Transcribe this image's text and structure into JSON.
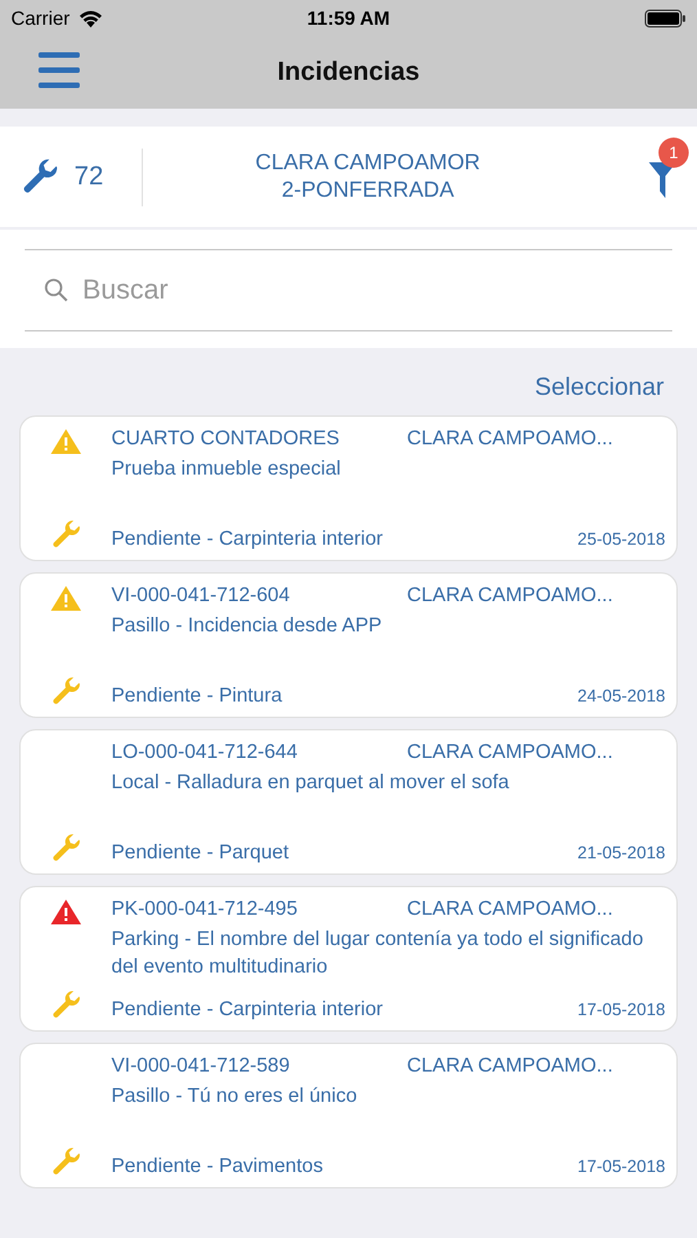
{
  "status_bar": {
    "carrier": "Carrier",
    "time": "11:59 AM"
  },
  "nav_bar": {
    "title": "Incidencias"
  },
  "header": {
    "count": "72",
    "building_line_1": "CLARA CAMPOAMOR",
    "building_line_2": "2-PONFERRADA",
    "filter_badge": "1"
  },
  "search": {
    "placeholder": "Buscar"
  },
  "select_link": "Seleccionar",
  "incidents": [
    {
      "code": "CUARTO CONTADORES",
      "location": "CLARA CAMPOAMO...",
      "description": "Prueba inmueble especial",
      "status": "Pendiente - Carpinteria interior",
      "date": "25-05-2018",
      "kind": "warning"
    },
    {
      "code": "VI-000-041-712-604",
      "location": "CLARA CAMPOAMO...",
      "description": "Pasillo - Incidencia desde APP",
      "status": "Pendiente - Pintura",
      "date": "24-05-2018",
      "kind": "warning"
    },
    {
      "code": "LO-000-041-712-644",
      "location": "CLARA CAMPOAMO...",
      "description": "Local - Ralladura en parquet al mover el sofa",
      "status": "Pendiente - Parquet",
      "date": "21-05-2018",
      "kind": "plain"
    },
    {
      "code": "PK-000-041-712-495",
      "location": "CLARA CAMPOAMO...",
      "description": "Parking - El nombre del lugar contenía ya todo el significado del evento multitudinario",
      "status": "Pendiente - Carpinteria interior",
      "date": "17-05-2018",
      "kind": "critical"
    },
    {
      "code": "VI-000-041-712-589",
      "location": "CLARA CAMPOAMO...",
      "description": "Pasillo - Tú no eres el único",
      "status": "Pendiente - Pavimentos",
      "date": "17-05-2018",
      "kind": "plain"
    }
  ]
}
